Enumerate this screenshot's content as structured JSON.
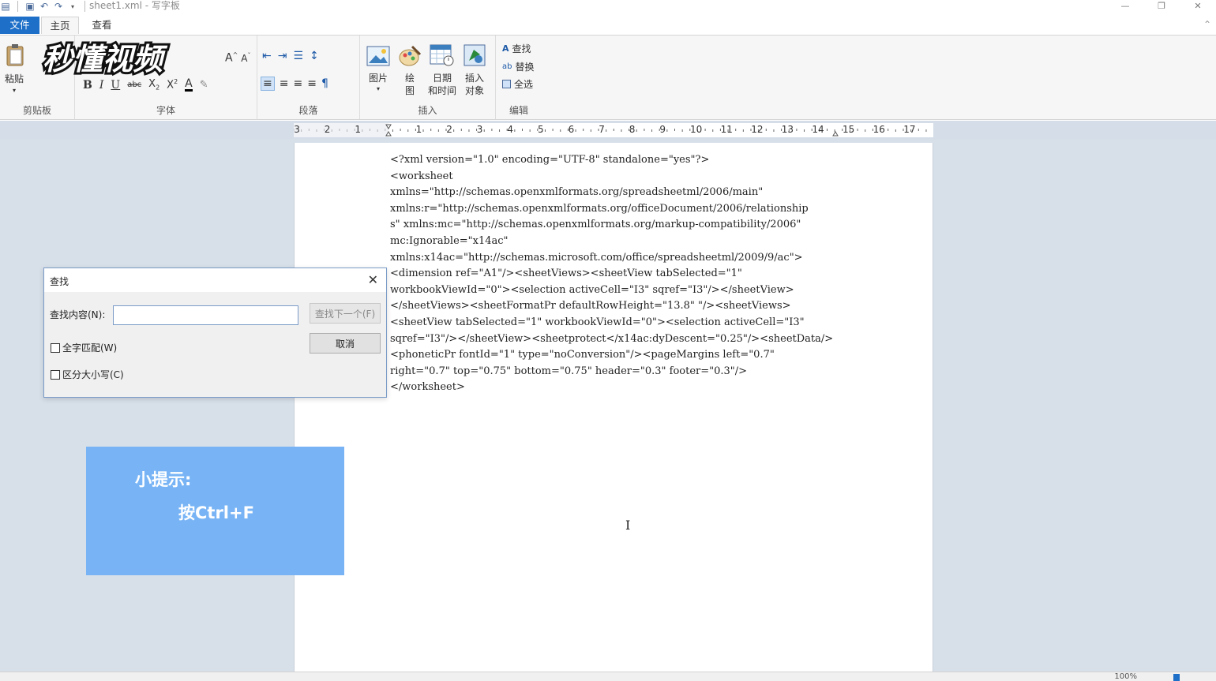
{
  "window": {
    "title": "sheet1.xml - 写字板"
  },
  "tabs": {
    "file": "文件",
    "home": "主页",
    "view": "查看"
  },
  "ribbon": {
    "clipboard": {
      "paste": "粘贴",
      "group_label": "剪贴板"
    },
    "font": {
      "group_label": "字体",
      "bold": "B",
      "italic": "I",
      "underline": "U"
    },
    "paragraph": {
      "group_label": "段落"
    },
    "insert": {
      "group_label": "插入",
      "picture": "图片",
      "paint_1": "绘",
      "paint_2": "图",
      "datetime_1": "日期",
      "datetime_2": "和时间",
      "object_1": "插入",
      "object_2": "对象"
    },
    "editing": {
      "group_label": "编辑",
      "find": "查找",
      "replace": "替换",
      "select_all": "全选"
    }
  },
  "watermark": "秒懂视频",
  "ruler": {
    "labels": [
      "3",
      "2",
      "1",
      "1",
      "2",
      "3",
      "4",
      "5",
      "6",
      "7",
      "8",
      "9",
      "10",
      "11",
      "12",
      "13",
      "14",
      "15",
      "16",
      "17"
    ]
  },
  "document": {
    "lines": [
      "<?xml version=\"1.0\" encoding=\"UTF-8\" standalone=\"yes\"?>",
      "<worksheet",
      "xmlns=\"http://schemas.openxmlformats.org/spreadsheetml/2006/main\"",
      "xmlns:r=\"http://schemas.openxmlformats.org/officeDocument/2006/relationship",
      "s\" xmlns:mc=\"http://schemas.openxmlformats.org/markup-compatibility/2006\"",
      "mc:Ignorable=\"x14ac\"",
      "xmlns:x14ac=\"http://schemas.microsoft.com/office/spreadsheetml/2009/9/ac\">",
      "<dimension ref=\"A1\"/><sheetViews><sheetView tabSelected=\"1\"",
      "workbookViewId=\"0\"><selection activeCell=\"I3\" sqref=\"I3\"/></sheetView>",
      "</sheetViews><sheetFormatPr defaultRowHeight=\"13.8\" \"/><sheetViews>",
      "<sheetView tabSelected=\"1\" workbookViewId=\"0\"><selection activeCell=\"I3\"",
      "sqref=\"I3\"/></sheetView><sheetprotect</x14ac:dyDescent=\"0.25\"/><sheetData/>",
      "<phoneticPr fontId=\"1\" type=\"noConversion\"/><pageMargins left=\"0.7\"",
      "right=\"0.7\" top=\"0.75\" bottom=\"0.75\" header=\"0.3\" footer=\"0.3\"/>",
      "</worksheet>"
    ]
  },
  "find_dialog": {
    "title": "查找",
    "find_label": "查找内容(N):",
    "find_value": "",
    "find_next": "查找下一个(F)",
    "cancel": "取消",
    "match_whole": "全字匹配(W)",
    "match_case": "区分大小写(C)"
  },
  "tip": {
    "title": "小提示:",
    "body": "按Ctrl+F"
  },
  "status": {
    "zoom": "100%"
  },
  "colors": {
    "file_tab": "#1e6fc8",
    "tip_box": "#78b4f5",
    "workspace": "#d7dfe9"
  }
}
